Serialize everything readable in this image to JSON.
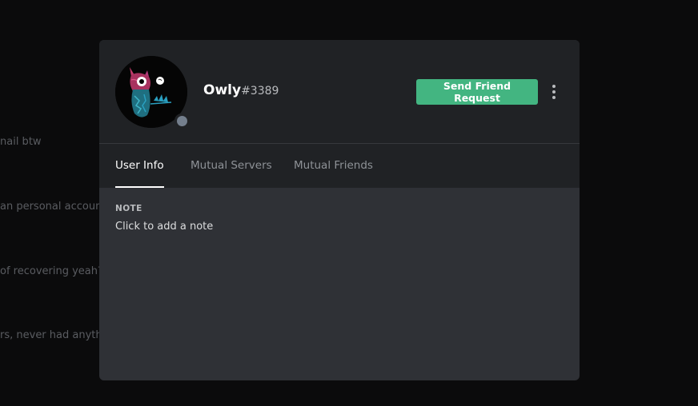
{
  "background_messages": [
    "nail btw",
    "an personal account",
    "of recovering yeah?",
    "rs, never had anythi"
  ],
  "profile": {
    "username": "Owly",
    "discriminator": "#3389",
    "status": "offline",
    "avatar_icon": "owl-avatar-icon",
    "status_color": "#747f8d"
  },
  "actions": {
    "send_friend_request": "Send Friend Request",
    "more_icon": "more-vertical-icon",
    "button_color": "#43b581"
  },
  "tabs": [
    {
      "label": "User Info",
      "active": true
    },
    {
      "label": "Mutual Servers",
      "active": false
    },
    {
      "label": "Mutual Friends",
      "active": false
    }
  ],
  "user_info": {
    "note_label": "NOTE",
    "note_placeholder": "Click to add a note"
  }
}
